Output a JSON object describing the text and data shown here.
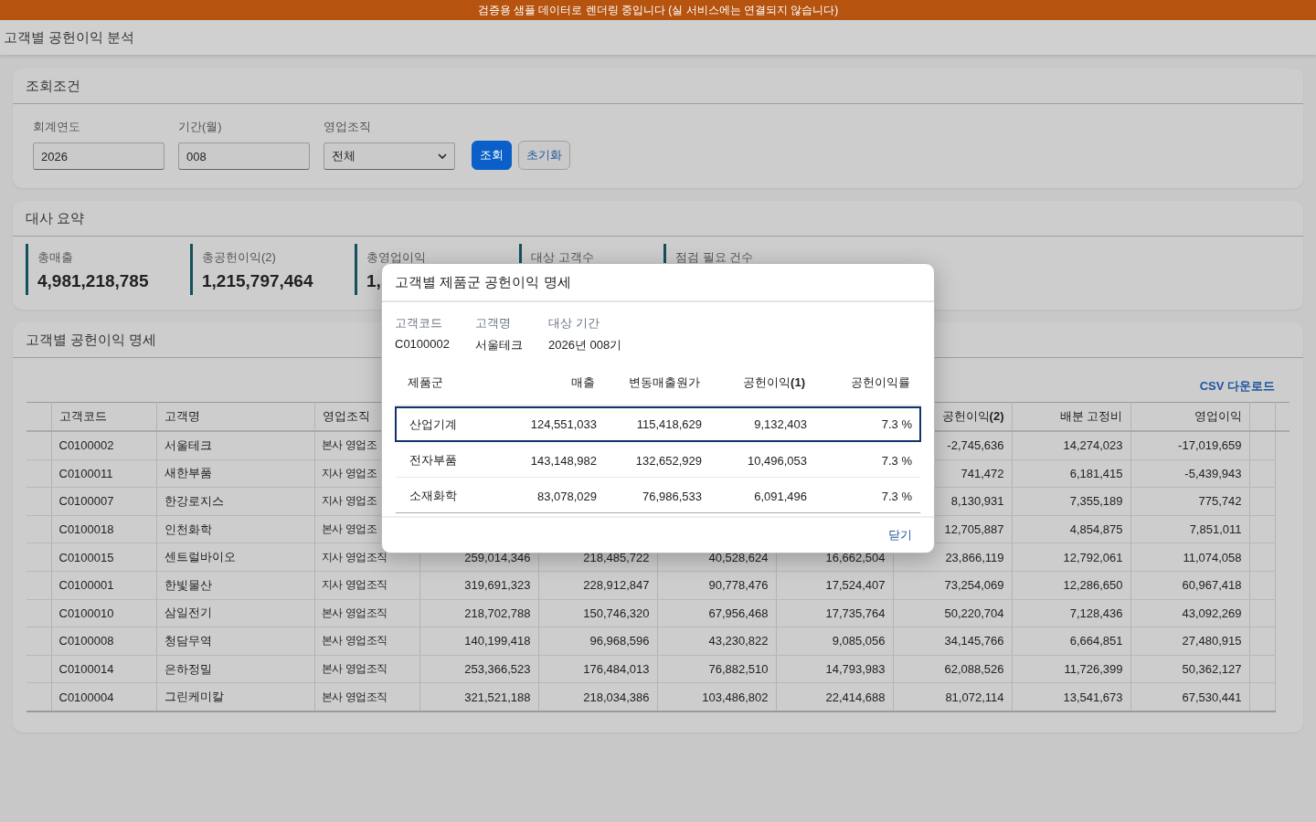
{
  "banner": "검증용 샘플 데이터로 렌더링 중입니다 (실 서비스에는 연결되지 않습니다)",
  "page_title": "고객별 공헌이익 분석",
  "filter_panel": {
    "title": "조회조건",
    "fields": [
      {
        "label": "회계연도",
        "value": "2026",
        "kind": "input"
      },
      {
        "label": "기간(월)",
        "value": "008",
        "kind": "input"
      },
      {
        "label": "영업조직",
        "value": "전체",
        "kind": "select"
      }
    ],
    "buttons": [
      {
        "label": "조회",
        "kind": "primary"
      },
      {
        "label": "초기화",
        "kind": "secondary"
      }
    ]
  },
  "summary_panel": {
    "title": "대사 요약",
    "cards": [
      {
        "label": "총매출",
        "value": "4,981,218,785"
      },
      {
        "label": "총공헌이익(2)",
        "value": "1,215,797,464"
      },
      {
        "label": "총영업이익",
        "value": "1,"
      },
      {
        "label": "대상 고객수"
      },
      {
        "label": "점검 필요 건수"
      }
    ]
  },
  "detail_panel": {
    "title": "고객별 공헌이익 명세",
    "csv_link": "CSV 다운로드",
    "table": {
      "columns": [
        "고객코드",
        "고객명",
        "영업조직",
        null,
        null,
        null,
        null,
        "공헌이익**(2)**",
        "배분 고정비",
        "영업이익"
      ],
      "rows": [
        [
          "C0100002",
          "서울테크",
          "본사 영업조",
          null,
          null,
          null,
          null,
          "-2,745,636",
          "14,274,023",
          "-17,019,659"
        ],
        [
          "C0100011",
          "새한부품",
          "지사 영업조",
          null,
          null,
          null,
          null,
          "741,472",
          "6,181,415",
          "-5,439,943"
        ],
        [
          "C0100007",
          "한강로지스",
          "지사 영업조",
          null,
          null,
          null,
          null,
          "8,130,931",
          "7,355,189",
          "775,742"
        ],
        [
          "C0100018",
          "인천화학",
          "본사 영업조",
          null,
          null,
          null,
          null,
          "12,705,887",
          "4,854,875",
          "7,851,011"
        ],
        [
          "C0100015",
          "센트럴바이오",
          "지사 영업조직",
          "259,014,346",
          "218,485,722",
          "40,528,624",
          "16,662,504",
          "23,866,119",
          "12,792,061",
          "11,074,058"
        ],
        [
          "C0100001",
          "한빛물산",
          "지사 영업조직",
          "319,691,323",
          "228,912,847",
          "90,778,476",
          "17,524,407",
          "73,254,069",
          "12,286,650",
          "60,967,418"
        ],
        [
          "C0100010",
          "삼일전기",
          "본사 영업조직",
          "218,702,788",
          "150,746,320",
          "67,956,468",
          "17,735,764",
          "50,220,704",
          "7,128,436",
          "43,092,269"
        ],
        [
          "C0100008",
          "청담무역",
          "본사 영업조직",
          "140,199,418",
          "96,968,596",
          "43,230,822",
          "9,085,056",
          "34,145,766",
          "6,664,851",
          "27,480,915"
        ],
        [
          "C0100014",
          "은하정밀",
          "본사 영업조직",
          "253,366,523",
          "176,484,013",
          "76,882,510",
          "14,793,983",
          "62,088,526",
          "11,726,399",
          "50,362,127"
        ],
        [
          "C0100004",
          "그린케미칼",
          "본사 영업조직",
          "321,521,188",
          "218,034,386",
          "103,486,802",
          "22,414,688",
          "81,072,114",
          "13,541,673",
          "67,530,441"
        ]
      ]
    }
  },
  "modal": {
    "title": "고객별 제품군 공헌이익 명세",
    "info": [
      {
        "label": "고객코드",
        "value": "C0100002"
      },
      {
        "label": "고객명",
        "value": "서울테크"
      },
      {
        "label": "대상 기간",
        "value": "2026년 008기"
      }
    ],
    "table": {
      "columns": [
        "제품군",
        "매출",
        "변동매출원가",
        "공헌이익**(1)**",
        "공헌이익률"
      ],
      "rows": [
        {
          "cells": [
            "산업기계",
            "124,551,033",
            "115,418,629",
            "9,132,403",
            "7.3 %"
          ],
          "selected": true
        },
        {
          "cells": [
            "전자부품",
            "143,148,982",
            "132,652,929",
            "10,496,053",
            "7.3 %"
          ],
          "selected": false
        },
        {
          "cells": [
            "소재화학",
            "83,078,029",
            "76,986,533",
            "6,091,496",
            "7.3 %"
          ],
          "selected": false
        }
      ]
    },
    "close_button": "닫기"
  }
}
